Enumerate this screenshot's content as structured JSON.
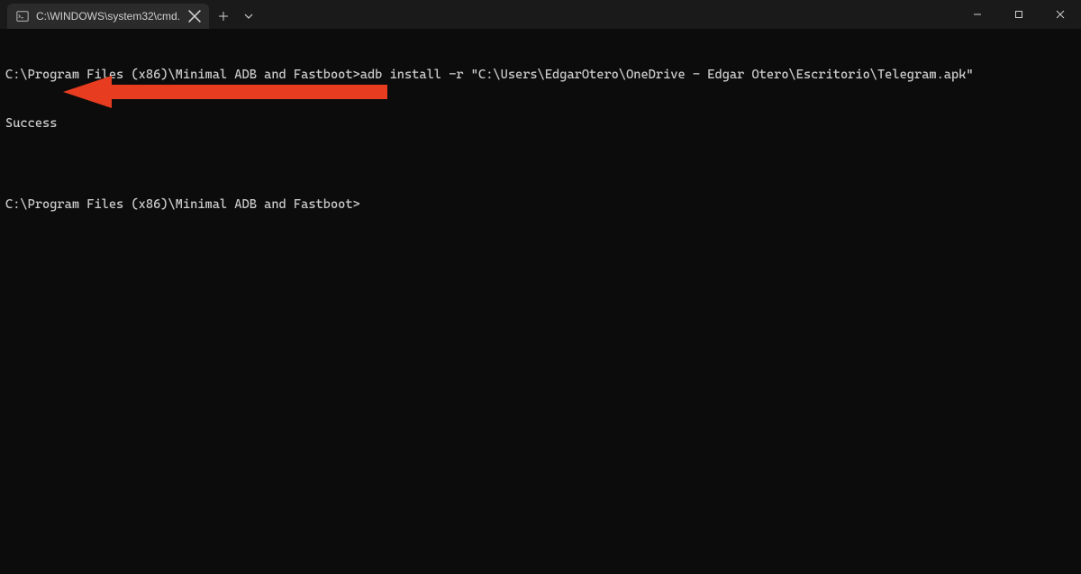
{
  "titlebar": {
    "tab": {
      "title": "C:\\WINDOWS\\system32\\cmd."
    }
  },
  "terminal": {
    "lines": [
      "C:\\Program Files (x86)\\Minimal ADB and Fastboot>adb install -r \"C:\\Users\\EdgarOtero\\OneDrive - Edgar Otero\\Escritorio\\Telegram.apk\"",
      "Success",
      "",
      "C:\\Program Files (x86)\\Minimal ADB and Fastboot>"
    ]
  },
  "annotation": {
    "arrow_color": "#e73c1f"
  }
}
